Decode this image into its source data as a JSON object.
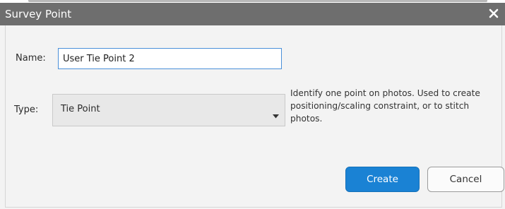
{
  "dialog": {
    "title": "Survey Point",
    "close_icon": "close-icon"
  },
  "form": {
    "name_label": "Name:",
    "name_value": "User Tie Point 2",
    "type_label": "Type:",
    "type_value": "Tie Point",
    "type_hint": "Identify one point on photos. Used to create positioning/scaling constraint, or to stitch photos."
  },
  "buttons": {
    "create_label": "Create",
    "cancel_label": "Cancel"
  },
  "colors": {
    "titlebar": "#6e6e6e",
    "accent": "#1a82d4",
    "input_focus_border": "#4a90d9"
  }
}
